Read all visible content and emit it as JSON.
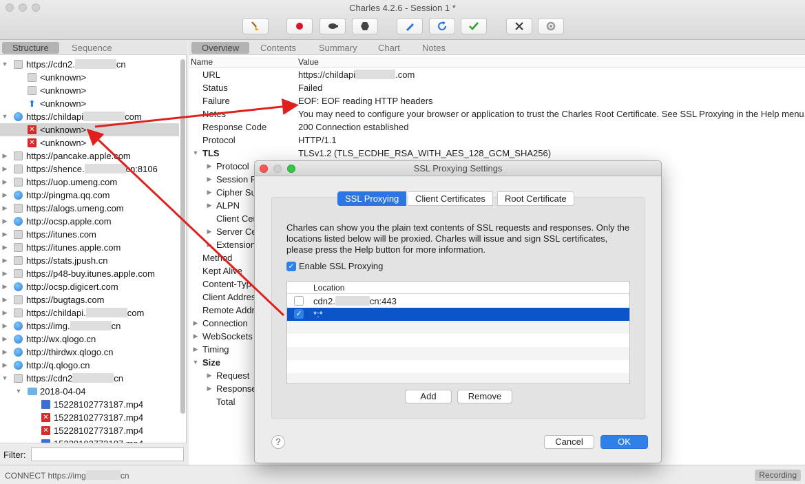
{
  "window": {
    "title": "Charles 4.2.6 - Session 1 *"
  },
  "toolbar": [
    {
      "name": "broom-icon",
      "color": "#e8a317"
    },
    {
      "name": "record-icon",
      "color": "#d8152a"
    },
    {
      "name": "throttle-turtle-icon",
      "color": "#444444"
    },
    {
      "name": "breakpoint-hexagon-icon",
      "color": "#444444"
    },
    {
      "name": "pen-compose-icon",
      "color": "#2b6fd6"
    },
    {
      "name": "refresh-icon",
      "color": "#2b6fd6"
    },
    {
      "name": "validate-check-icon",
      "color": "#2aa52a"
    },
    {
      "name": "tools-icon",
      "color": "#333333"
    },
    {
      "name": "settings-gear-icon",
      "color": "#999999"
    }
  ],
  "left": {
    "tabs": [
      "Structure",
      "Sequence"
    ],
    "filter_label": "Filter:"
  },
  "tree": [
    {
      "tw": "▼",
      "icon": "lock",
      "d": 0,
      "pre": "https://cdn2.",
      "post": "cn"
    },
    {
      "tw": "",
      "icon": "lock",
      "d": 1,
      "pre": "<unknown>",
      "post": ""
    },
    {
      "tw": "",
      "icon": "lock",
      "d": 1,
      "pre": "<unknown>",
      "post": ""
    },
    {
      "tw": "",
      "icon": "up",
      "d": 1,
      "pre": "<unknown>",
      "post": ""
    },
    {
      "tw": "▼",
      "icon": "globe",
      "d": 0,
      "pre": "https://childapi",
      "post": "com"
    },
    {
      "tw": "",
      "icon": "err",
      "d": 1,
      "pre": "<unknown>",
      "post": "",
      "sel": true
    },
    {
      "tw": "",
      "icon": "err",
      "d": 1,
      "pre": "<unknown>",
      "post": ""
    },
    {
      "tw": "▶",
      "icon": "lock",
      "d": 0,
      "pre": "https://pancake.apple.com",
      "post": ""
    },
    {
      "tw": "▶",
      "icon": "lock",
      "d": 0,
      "pre": "https://shence.",
      "post": "cn:8106"
    },
    {
      "tw": "▶",
      "icon": "lock",
      "d": 0,
      "pre": "https://uop.umeng.com",
      "post": ""
    },
    {
      "tw": "▶",
      "icon": "globe",
      "d": 0,
      "pre": "http://pingma.qq.com",
      "post": ""
    },
    {
      "tw": "▶",
      "icon": "lock",
      "d": 0,
      "pre": "https://alogs.umeng.com",
      "post": ""
    },
    {
      "tw": "▶",
      "icon": "globe",
      "d": 0,
      "pre": "http://ocsp.apple.com",
      "post": ""
    },
    {
      "tw": "▶",
      "icon": "lock",
      "d": 0,
      "pre": "https://itunes.com",
      "post": ""
    },
    {
      "tw": "▶",
      "icon": "lock",
      "d": 0,
      "pre": "https://itunes.apple.com",
      "post": ""
    },
    {
      "tw": "▶",
      "icon": "lock",
      "d": 0,
      "pre": "https://stats.jpush.cn",
      "post": ""
    },
    {
      "tw": "▶",
      "icon": "lock",
      "d": 0,
      "pre": "https://p48-buy.itunes.apple.com",
      "post": ""
    },
    {
      "tw": "▶",
      "icon": "globe",
      "d": 0,
      "pre": "http://ocsp.digicert.com",
      "post": ""
    },
    {
      "tw": "▶",
      "icon": "lock",
      "d": 0,
      "pre": "https://bugtags.com",
      "post": ""
    },
    {
      "tw": "▶",
      "icon": "lock",
      "d": 0,
      "pre": "https://childapi.",
      "post": "com"
    },
    {
      "tw": "▶",
      "icon": "globe",
      "d": 0,
      "pre": "https://img.",
      "post": "cn"
    },
    {
      "tw": "▶",
      "icon": "globe",
      "d": 0,
      "pre": "http://wx.qlogo.cn",
      "post": ""
    },
    {
      "tw": "▶",
      "icon": "globe",
      "d": 0,
      "pre": "http://thirdwx.qlogo.cn",
      "post": ""
    },
    {
      "tw": "▶",
      "icon": "globe",
      "d": 0,
      "pre": "http://q.qlogo.cn",
      "post": ""
    },
    {
      "tw": "▼",
      "icon": "lock",
      "d": 0,
      "pre": "https://cdn2",
      "post": "cn"
    },
    {
      "tw": "▼",
      "icon": "folder",
      "d": 1,
      "pre": "2018-04-04",
      "post": ""
    },
    {
      "tw": "",
      "icon": "film",
      "d": 2,
      "pre": "15228102773187.mp4",
      "post": ""
    },
    {
      "tw": "",
      "icon": "err",
      "d": 2,
      "pre": "15228102773187.mp4",
      "post": ""
    },
    {
      "tw": "",
      "icon": "err",
      "d": 2,
      "pre": "15228102773187.mp4",
      "post": ""
    },
    {
      "tw": "",
      "icon": "film",
      "d": 2,
      "pre": "15228102773187.mp4",
      "post": ""
    }
  ],
  "right": {
    "tabs": [
      "Overview",
      "Contents",
      "Summary",
      "Chart",
      "Notes"
    ],
    "col_name": "Name",
    "col_value": "Value"
  },
  "overview": [
    {
      "n": "URL",
      "pre": "https://childapi",
      "post": ".com"
    },
    {
      "n": "Status",
      "v": "Failed"
    },
    {
      "n": "Failure",
      "v": "EOF: EOF reading HTTP headers"
    },
    {
      "n": "Notes",
      "v": "You may need to configure your browser or application to trust the Charles Root Certificate. See SSL Proxying in the Help menu."
    },
    {
      "n": "Response Code",
      "v": "200 Connection established"
    },
    {
      "n": "Protocol",
      "v": "HTTP/1.1"
    },
    {
      "n": "TLS",
      "v": "TLSv1.2 (TLS_ECDHE_RSA_WITH_AES_128_GCM_SHA256)",
      "tw": "▼",
      "bold": true
    },
    {
      "n": "Protocol",
      "indent": 1,
      "tw": "▶"
    },
    {
      "n": "Session R",
      "indent": 1,
      "tw": "▶"
    },
    {
      "n": "Cipher Su",
      "indent": 1,
      "tw": "▶"
    },
    {
      "n": "ALPN",
      "indent": 1,
      "tw": "▶"
    },
    {
      "n": "Client Cer",
      "indent": 1
    },
    {
      "n": "Server Ce",
      "indent": 1,
      "tw": "▶"
    },
    {
      "n": "Extension",
      "indent": 1,
      "tw": "▶"
    },
    {
      "n": "Method"
    },
    {
      "n": "Kept Alive"
    },
    {
      "n": "Content-Typ"
    },
    {
      "n": "Client Addres"
    },
    {
      "n": "Remote Addre"
    },
    {
      "n": "Connection",
      "tw": "▶"
    },
    {
      "n": "WebSockets",
      "tw": "▶"
    },
    {
      "n": "Timing",
      "tw": "▶"
    },
    {
      "n": "Size",
      "tw": "▼",
      "bold": true
    },
    {
      "n": "Request",
      "indent": 1,
      "tw": "▶"
    },
    {
      "n": "Response",
      "indent": 1,
      "tw": "▶"
    },
    {
      "n": "Total",
      "indent": 1
    }
  ],
  "status": {
    "text_pre": "CONNECT https://img",
    "text_post": "cn",
    "recording": "Recording"
  },
  "dialog": {
    "title": "SSL Proxying Settings",
    "tabs": [
      "SSL Proxying",
      "Client Certificates",
      "Root Certificate"
    ],
    "description": "Charles can show you the plain text contents of SSL requests and responses. Only the locations listed below will be proxied. Charles will issue and sign SSL certificates, please press the Help button for more information.",
    "enable_label": "Enable SSL Proxying",
    "enable_checked": true,
    "location_header": "Location",
    "locations": [
      {
        "pre": "cdn2.",
        "post": "cn:443",
        "checked": false
      },
      {
        "pre": "*:*",
        "post": "",
        "checked": true
      }
    ],
    "add": "Add",
    "remove": "Remove",
    "help": "?",
    "cancel": "Cancel",
    "ok": "OK"
  },
  "accent": "#2f80e8",
  "selection_blue": "#0b55c9",
  "arrow_color": "#e0201d"
}
